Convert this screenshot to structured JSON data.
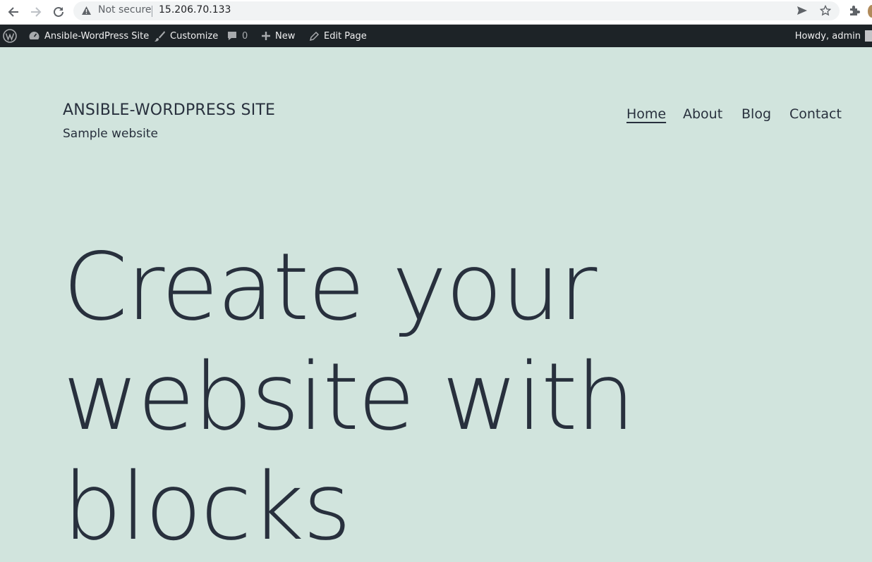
{
  "browser": {
    "security_label": "Not secure",
    "url": "15.206.70.133"
  },
  "adminbar": {
    "site_name": "Ansible-WordPress Site",
    "customize": "Customize",
    "comments_count": "0",
    "new": "New",
    "edit_page": "Edit Page",
    "howdy": "Howdy, admin"
  },
  "site": {
    "title": "ANSIBLE-WORDPRESS SITE",
    "description": "Sample website"
  },
  "menu": {
    "home": "Home",
    "about": "About",
    "blog": "Blog",
    "contact": "Contact"
  },
  "hero": {
    "line1": "Create your",
    "line2": "website with",
    "line3": "blocks"
  },
  "colors": {
    "background": "#d1e4dd",
    "text": "#28303d",
    "adminbar": "#1d2327"
  }
}
